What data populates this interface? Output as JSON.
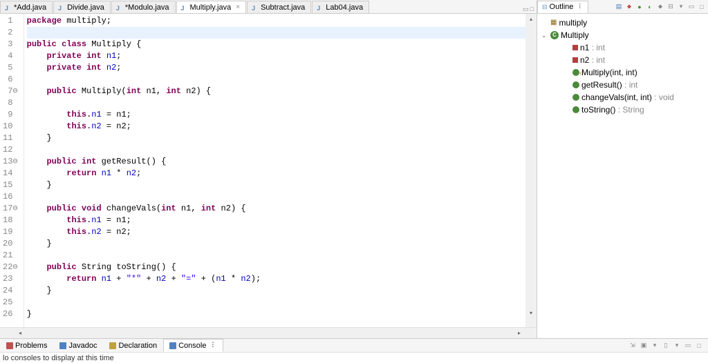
{
  "tabs": [
    {
      "label": "*Add.java",
      "dirty": true,
      "active": false
    },
    {
      "label": "Divide.java",
      "dirty": false,
      "active": false
    },
    {
      "label": "*Modulo.java",
      "dirty": true,
      "active": false
    },
    {
      "label": "Multiply.java",
      "dirty": false,
      "active": true
    },
    {
      "label": "Subtract.java",
      "dirty": false,
      "active": false
    },
    {
      "label": "Lab04.java",
      "dirty": false,
      "active": false
    }
  ],
  "code_lines": [
    {
      "n": "1",
      "fold": "",
      "html": "<span class='kw'>package</span> multiply;"
    },
    {
      "n": "2",
      "fold": "",
      "html": "",
      "hl": true
    },
    {
      "n": "3",
      "fold": "",
      "html": "<span class='kw'>public</span> <span class='kw'>class</span> Multiply {"
    },
    {
      "n": "4",
      "fold": "",
      "html": "    <span class='kw'>private</span> <span class='kw'>int</span> <span class='fld'>n1</span>;"
    },
    {
      "n": "5",
      "fold": "",
      "html": "    <span class='kw'>private</span> <span class='kw'>int</span> <span class='fld'>n2</span>;"
    },
    {
      "n": "6",
      "fold": "",
      "html": ""
    },
    {
      "n": "7",
      "fold": "⊖",
      "html": "    <span class='kw'>public</span> Multiply(<span class='kw'>int</span> n1, <span class='kw'>int</span> n2) {"
    },
    {
      "n": "8",
      "fold": "",
      "html": ""
    },
    {
      "n": "9",
      "fold": "",
      "html": "        <span class='kw'>this</span>.<span class='fld'>n1</span> = n1;"
    },
    {
      "n": "10",
      "fold": "",
      "html": "        <span class='kw'>this</span>.<span class='fld'>n2</span> = n2;"
    },
    {
      "n": "11",
      "fold": "",
      "html": "    }"
    },
    {
      "n": "12",
      "fold": "",
      "html": ""
    },
    {
      "n": "13",
      "fold": "⊖",
      "html": "    <span class='kw'>public</span> <span class='kw'>int</span> getResult() {"
    },
    {
      "n": "14",
      "fold": "",
      "html": "        <span class='kw'>return</span> <span class='fld'>n1</span> * <span class='fld'>n2</span>;"
    },
    {
      "n": "15",
      "fold": "",
      "html": "    }"
    },
    {
      "n": "16",
      "fold": "",
      "html": ""
    },
    {
      "n": "17",
      "fold": "⊖",
      "html": "    <span class='kw'>public</span> <span class='kw'>void</span> changeVals(<span class='kw'>int</span> n1, <span class='kw'>int</span> n2) {"
    },
    {
      "n": "18",
      "fold": "",
      "html": "        <span class='kw'>this</span>.<span class='fld'>n1</span> = n1;"
    },
    {
      "n": "19",
      "fold": "",
      "html": "        <span class='kw'>this</span>.<span class='fld'>n2</span> = n2;"
    },
    {
      "n": "20",
      "fold": "",
      "html": "    }"
    },
    {
      "n": "21",
      "fold": "",
      "html": ""
    },
    {
      "n": "22",
      "fold": "⊖",
      "html": "    <span class='kw'>public</span> String toString() {"
    },
    {
      "n": "23",
      "fold": "",
      "html": "        <span class='kw'>return</span> <span class='fld'>n1</span> + <span class='str'>\"*\"</span> + <span class='fld'>n2</span> + <span class='str'>\"=\"</span> + (<span class='fld'>n1</span> * <span class='fld'>n2</span>);"
    },
    {
      "n": "24",
      "fold": "",
      "html": "    }"
    },
    {
      "n": "25",
      "fold": "",
      "html": ""
    },
    {
      "n": "26",
      "fold": "",
      "html": "}"
    }
  ],
  "outline": {
    "title": "Outline",
    "package": "multiply",
    "class": "Multiply",
    "members": [
      {
        "icon": "field",
        "name": "n1",
        "suffix": " : int"
      },
      {
        "icon": "field",
        "name": "n2",
        "suffix": " : int"
      },
      {
        "icon": "ctor",
        "name": "Multiply(int, int)",
        "suffix": ""
      },
      {
        "icon": "method",
        "name": "getResult()",
        "suffix": " : int"
      },
      {
        "icon": "method",
        "name": "changeVals(int, int)",
        "suffix": " : void"
      },
      {
        "icon": "method",
        "name": "toString()",
        "suffix": " : String"
      }
    ]
  },
  "bottom_views": [
    {
      "label": "Problems",
      "icon_color": "#c05050",
      "active": false
    },
    {
      "label": "Javadoc",
      "icon_color": "#5080c0",
      "active": false
    },
    {
      "label": "Declaration",
      "icon_color": "#c0a040",
      "active": false
    },
    {
      "label": "Console",
      "icon_color": "#5080c0",
      "active": true
    }
  ],
  "status": "lo consoles to display at this time"
}
